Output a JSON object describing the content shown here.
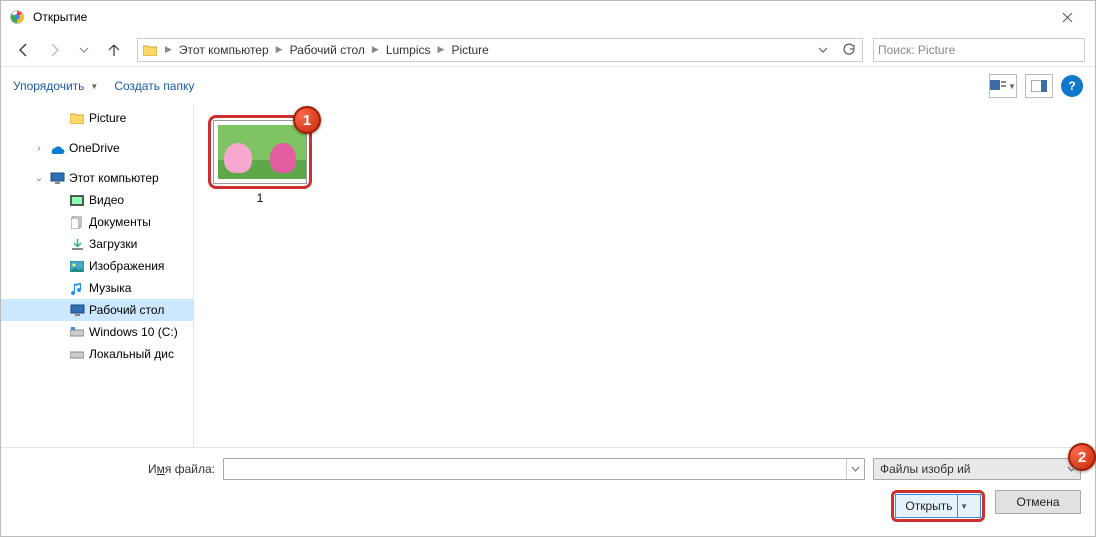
{
  "window": {
    "title": "Открытие"
  },
  "breadcrumb": [
    "Этот компьютер",
    "Рабочий стол",
    "Lumpics",
    "Picture"
  ],
  "search": {
    "placeholder": "Поиск: Picture"
  },
  "toolbar": {
    "organize": "Упорядочить",
    "new_folder": "Создать папку"
  },
  "sidebar": [
    {
      "label": "Picture",
      "icon": "folder",
      "indent": 2,
      "exp": ""
    },
    {
      "label": "OneDrive",
      "icon": "onedrive",
      "indent": 1,
      "exp": "›"
    },
    {
      "label": "Этот компьютер",
      "icon": "pc",
      "indent": 1,
      "exp": "⌄"
    },
    {
      "label": "Видео",
      "icon": "video",
      "indent": 2,
      "exp": ""
    },
    {
      "label": "Документы",
      "icon": "docs",
      "indent": 2,
      "exp": ""
    },
    {
      "label": "Загрузки",
      "icon": "downloads",
      "indent": 2,
      "exp": ""
    },
    {
      "label": "Изображения",
      "icon": "images",
      "indent": 2,
      "exp": ""
    },
    {
      "label": "Музыка",
      "icon": "music",
      "indent": 2,
      "exp": ""
    },
    {
      "label": "Рабочий стол",
      "icon": "desktop",
      "indent": 2,
      "exp": "",
      "selected": true
    },
    {
      "label": "Windows 10 (C:)",
      "icon": "drive",
      "indent": 2,
      "exp": ""
    },
    {
      "label": "Локальный дис",
      "icon": "drive",
      "indent": 2,
      "exp": ""
    }
  ],
  "file": {
    "label": "1"
  },
  "markers": {
    "one": "1",
    "two": "2"
  },
  "footer": {
    "filename_label_pre": "И",
    "filename_label_ul": "м",
    "filename_label_post": "я файла:",
    "filter": "Файлы изобр            ий",
    "open": "Открыть",
    "cancel": "Отмена"
  }
}
